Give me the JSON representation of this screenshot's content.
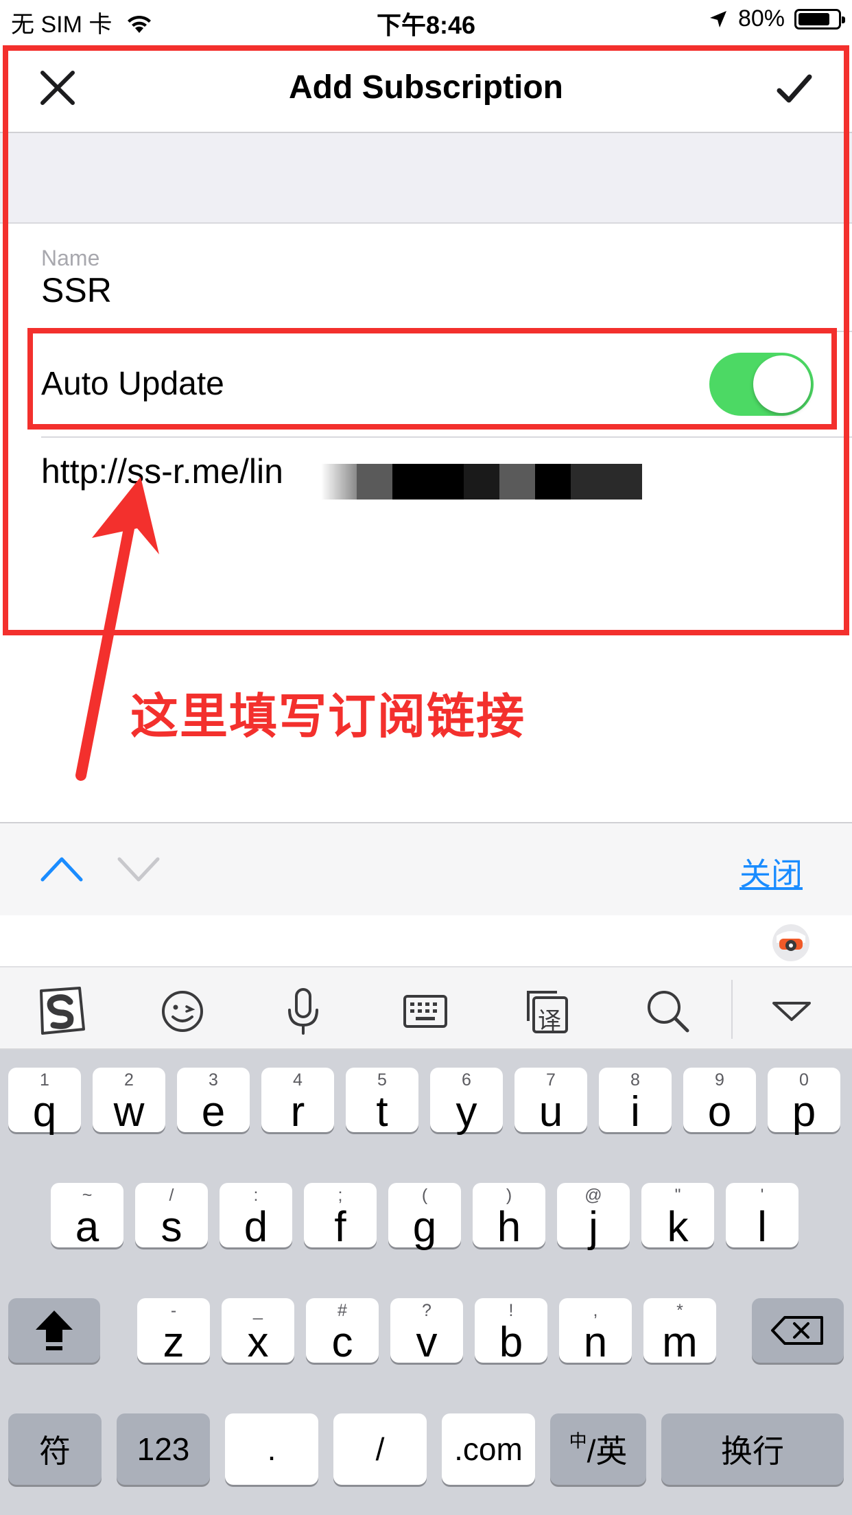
{
  "status_bar": {
    "carrier": "无 SIM 卡",
    "time": "下午8:46",
    "battery_percent": "80%",
    "battery_level": 0.8
  },
  "nav": {
    "title": "Add Subscription",
    "close_icon": "close-icon",
    "done_icon": "checkmark-icon"
  },
  "form": {
    "name_label": "Name",
    "name_value": "SSR",
    "auto_update_label": "Auto Update",
    "auto_update_on": true,
    "url_value": "http://ss-r.me/lin"
  },
  "annotation": {
    "text": "这里填写订阅链接",
    "color": "#f3302d"
  },
  "accessory": {
    "close_label": "关闭",
    "accent": "#1a8cff"
  },
  "ime_toolbar": {
    "icons": [
      "sogou-logo-icon",
      "emoji-icon",
      "microphone-icon",
      "keyboard-icon",
      "translate-icon",
      "search-icon",
      "collapse-triangle-icon"
    ],
    "translate_glyph": "译"
  },
  "keyboard": {
    "row1": [
      {
        "sub": "1",
        "main": "q"
      },
      {
        "sub": "2",
        "main": "w"
      },
      {
        "sub": "3",
        "main": "e"
      },
      {
        "sub": "4",
        "main": "r"
      },
      {
        "sub": "5",
        "main": "t"
      },
      {
        "sub": "6",
        "main": "y"
      },
      {
        "sub": "7",
        "main": "u"
      },
      {
        "sub": "8",
        "main": "i"
      },
      {
        "sub": "9",
        "main": "o"
      },
      {
        "sub": "0",
        "main": "p"
      }
    ],
    "row2": [
      {
        "sub": "~",
        "main": "a"
      },
      {
        "sub": "/",
        "main": "s"
      },
      {
        "sub": ":",
        "main": "d"
      },
      {
        "sub": ";",
        "main": "f"
      },
      {
        "sub": "(",
        "main": "g"
      },
      {
        "sub": ")",
        "main": "h"
      },
      {
        "sub": "@",
        "main": "j"
      },
      {
        "sub": "\"",
        "main": "k"
      },
      {
        "sub": "'",
        "main": "l"
      }
    ],
    "row3": [
      {
        "sub": "-",
        "main": "z"
      },
      {
        "sub": "_",
        "main": "x"
      },
      {
        "sub": "#",
        "main": "c"
      },
      {
        "sub": "?",
        "main": "v"
      },
      {
        "sub": "!",
        "main": "b"
      },
      {
        "sub": ",",
        "main": "n"
      },
      {
        "sub": "*",
        "main": "m"
      }
    ],
    "bottom": {
      "symbols": "符",
      "numbers": "123",
      "period": ".",
      "slash": "/",
      "dotcom": ".com",
      "lang_small": "中",
      "lang_main": "/英",
      "return": "换行"
    }
  }
}
